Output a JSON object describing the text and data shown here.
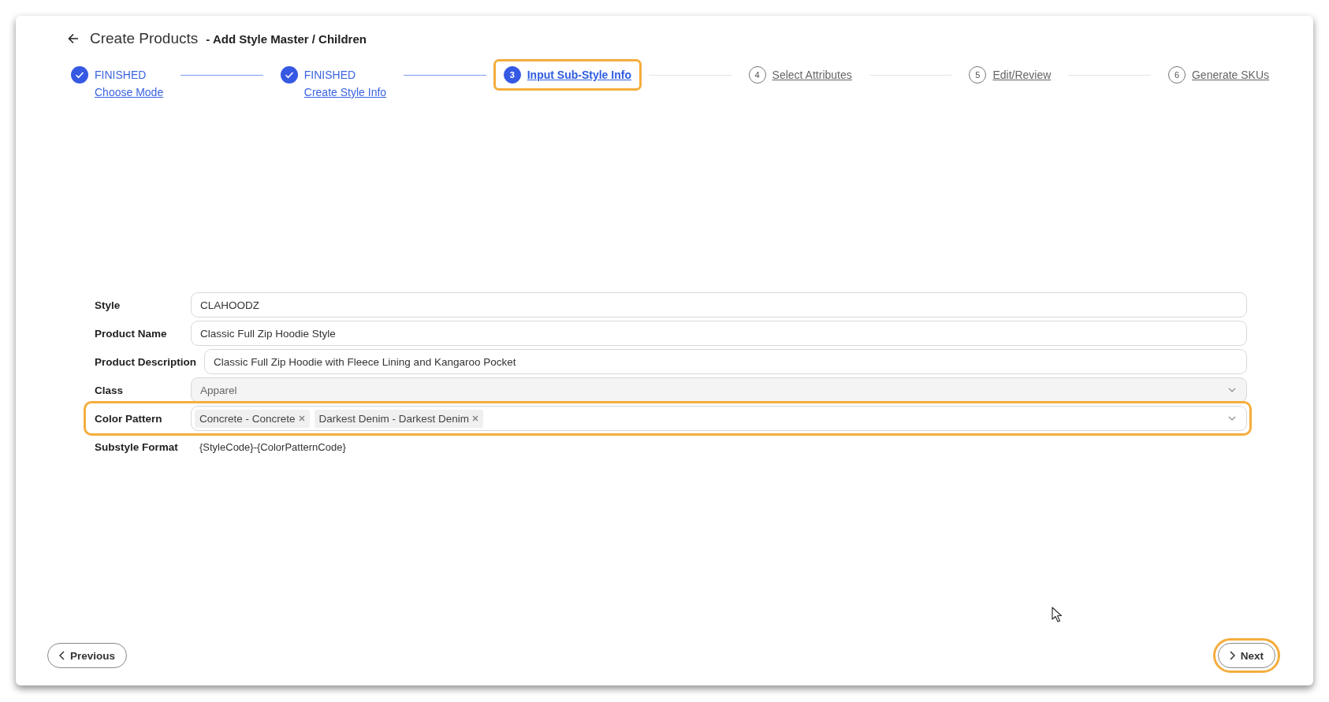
{
  "header": {
    "title": "Create Products",
    "subtitle": "- Add Style Master / Children"
  },
  "steps": [
    {
      "kind": "finished",
      "status_label": "FINISHED",
      "label": "Choose Mode",
      "selected": false,
      "highlighted": false
    },
    {
      "kind": "finished",
      "status_label": "FINISHED",
      "label": "Create Style Info",
      "selected": false,
      "highlighted": false
    },
    {
      "kind": "current",
      "number": "3",
      "label": "Input Sub-Style Info",
      "selected": true,
      "highlighted": true
    },
    {
      "kind": "waiting",
      "number": "4",
      "label": "Select Attributes",
      "selected": false,
      "highlighted": false
    },
    {
      "kind": "waiting",
      "number": "5",
      "label": "Edit/Review",
      "selected": false,
      "highlighted": false
    },
    {
      "kind": "waiting",
      "number": "6",
      "label": "Generate SKUs",
      "selected": false,
      "highlighted": false
    }
  ],
  "fields": [
    {
      "kind": "text",
      "label": "Style",
      "value": "CLAHOODZ",
      "disabled": false,
      "highlighted": false
    },
    {
      "kind": "text",
      "label": "Product Name",
      "value": "Classic Full Zip Hoodie Style",
      "disabled": false,
      "highlighted": false
    },
    {
      "kind": "text",
      "label": "Product Description",
      "value": "Classic Full Zip Hoodie with Fleece Lining and Kangaroo Pocket",
      "disabled": false,
      "highlighted": false
    },
    {
      "kind": "select",
      "label": "Class",
      "value": "Apparel",
      "disabled": true,
      "highlighted": false
    },
    {
      "kind": "multiselect",
      "label": "Color Pattern",
      "tags": [
        "Concrete - Concrete",
        "Darkest Denim - Darkest Denim"
      ],
      "disabled": false,
      "highlighted": true
    },
    {
      "kind": "static",
      "label": "Substyle Format",
      "value": "{StyleCode}-{ColorPatternCode}",
      "disabled": false,
      "highlighted": false
    }
  ],
  "footer": {
    "previous": {
      "label": "Previous",
      "highlighted": false
    },
    "next": {
      "label": "Next",
      "highlighted": true
    }
  }
}
